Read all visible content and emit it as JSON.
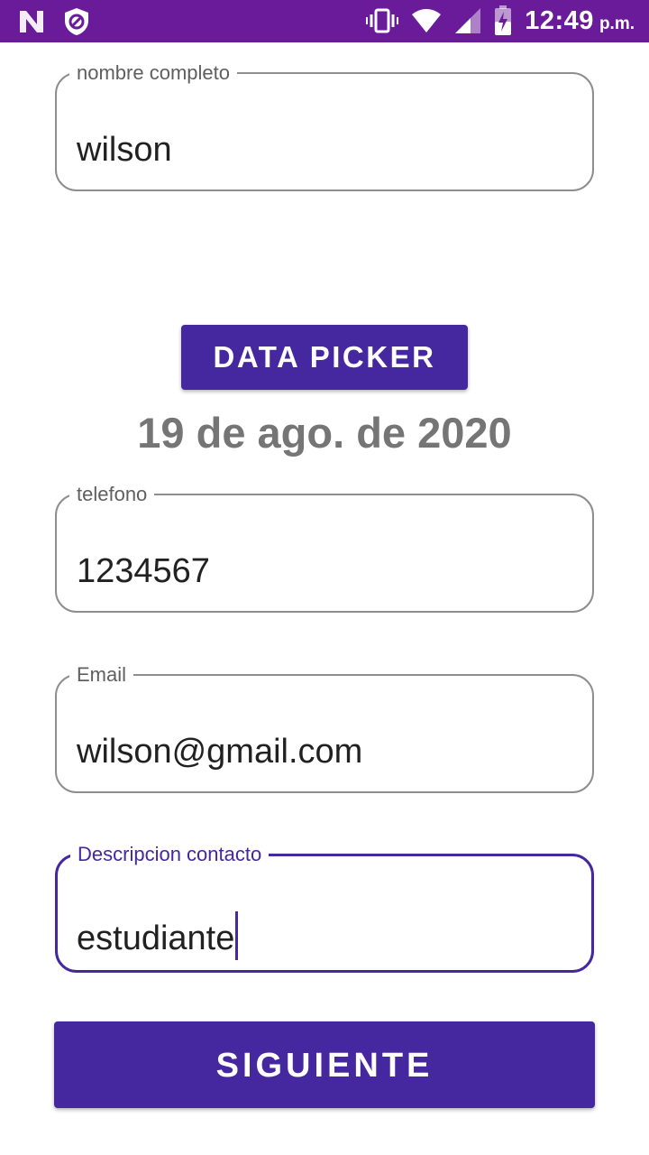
{
  "status_bar": {
    "time": "12:49",
    "ampm": "p.m.",
    "background": "#6a1b9a",
    "icons": [
      "n-notification-icon",
      "blocked-shield-icon",
      "vibrate-icon",
      "wifi-icon",
      "cell-signal-icon",
      "battery-charging-icon"
    ]
  },
  "form": {
    "nombre": {
      "label": "nombre completo",
      "value": "wilson"
    },
    "picker_button": "DATA PICKER",
    "selected_date": "19 de ago. de 2020",
    "telefono": {
      "label": "telefono",
      "value": "1234567"
    },
    "email": {
      "label": "Email",
      "value": "wilson@gmail.com"
    },
    "descripcion": {
      "label": "Descripcion contacto",
      "value": "estudiante"
    },
    "next_button": "SIGUIENTE"
  },
  "colors": {
    "accent": "#4527a0",
    "outline": "#8e8e8e",
    "date_text": "#757575"
  }
}
